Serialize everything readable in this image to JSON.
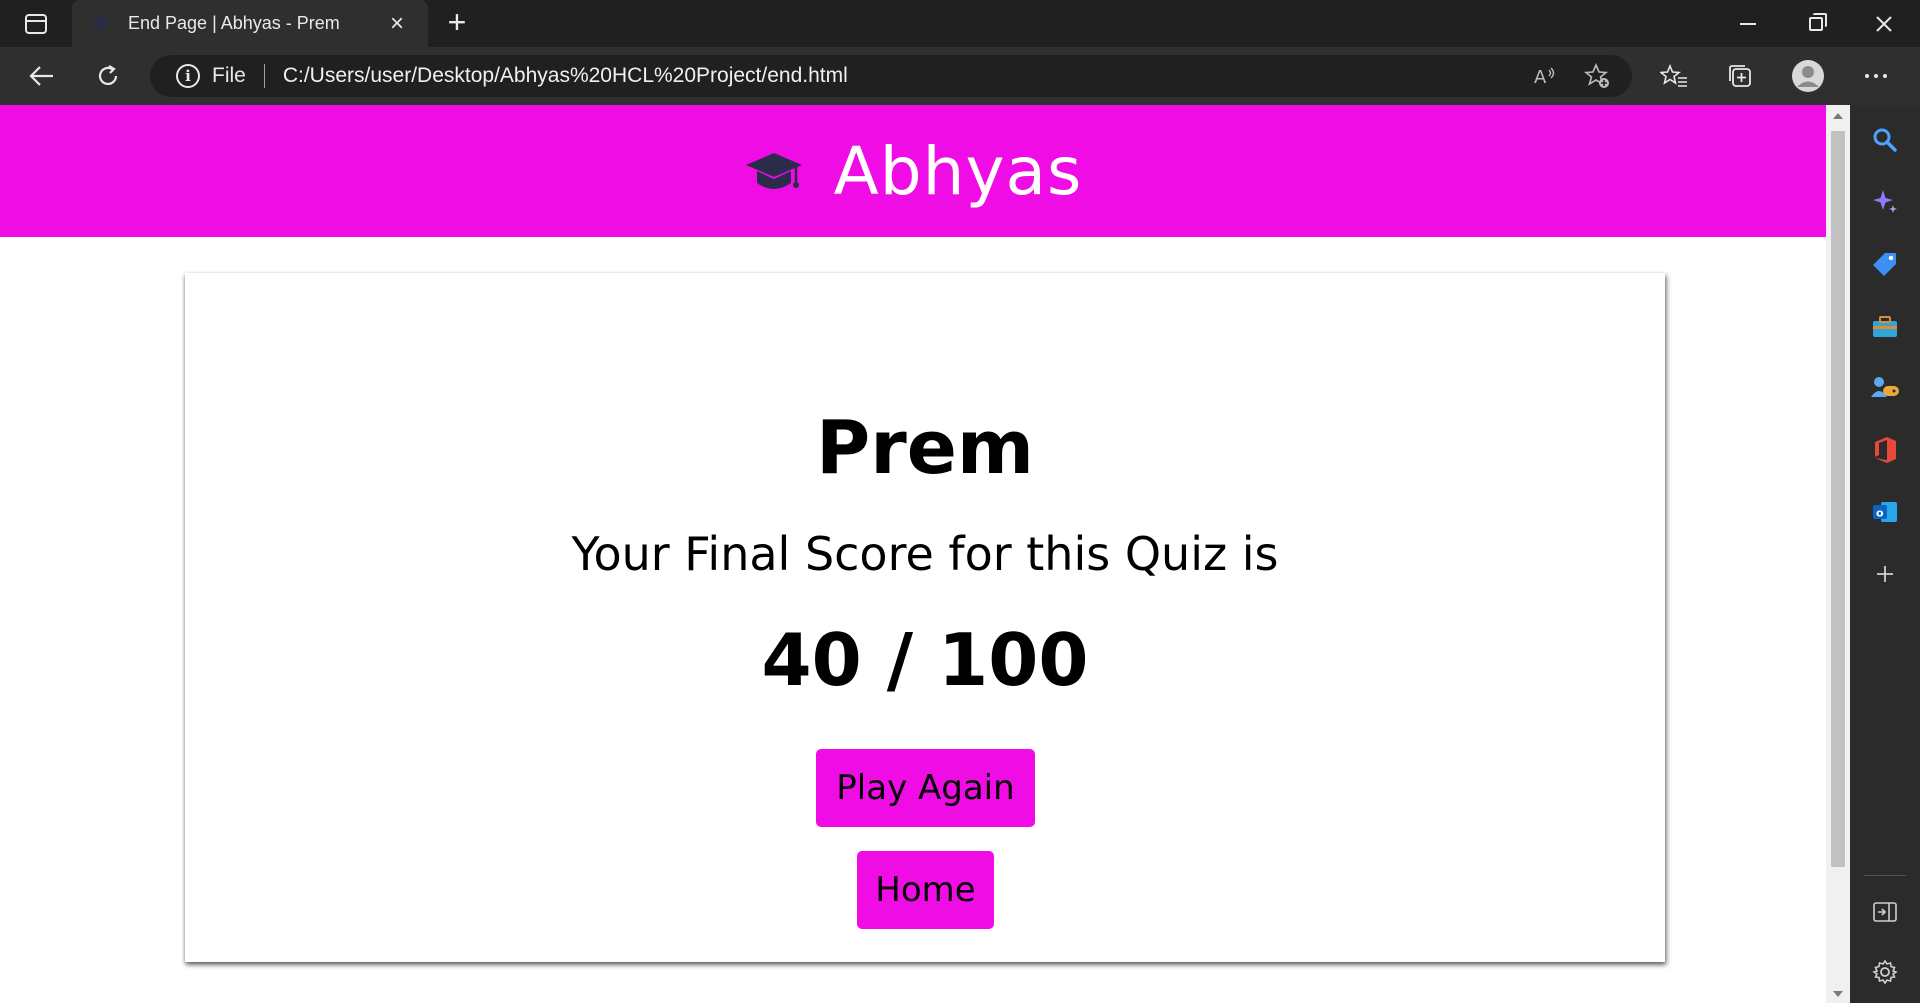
{
  "browser": {
    "tab": {
      "title": "End Page | Abhyas - Prem",
      "close_glyph": "×"
    },
    "new_tab_glyph": "+",
    "address": {
      "scheme_label": "File",
      "url": "C:/Users/user/Desktop/Abhyas%20HCL%20Project/end.html",
      "info_glyph": "i"
    },
    "toolbar_icons": [
      "back-icon",
      "refresh-icon",
      "read-aloud-icon",
      "add-favorite-icon",
      "favorites-icon",
      "collections-icon",
      "profile-icon",
      "more-icon"
    ],
    "sidebar_icons": [
      "search-icon",
      "copilot-icon",
      "shopping-icon",
      "tools-icon",
      "games-icon",
      "office-icon",
      "outlook-icon",
      "add-icon",
      "hide-sidebar-icon",
      "settings-icon"
    ]
  },
  "site": {
    "brand": "Abhyas",
    "brand_color": "#f00ce4",
    "icon": "graduation-cap-icon"
  },
  "result": {
    "player_name": "Prem",
    "message": "Your Final Score for this Quiz is",
    "score": "40 / 100",
    "play_again_label": "Play Again",
    "home_label": "Home"
  }
}
